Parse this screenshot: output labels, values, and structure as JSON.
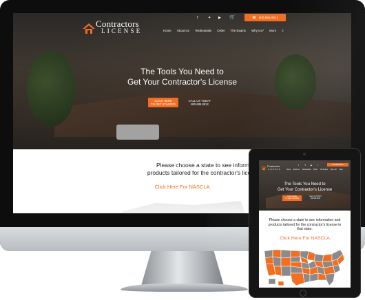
{
  "site": {
    "logo_line1": "Contractors",
    "logo_line2": "LICENSE",
    "phone": "800.685.0812",
    "nav": [
      "Home",
      "About Us",
      "Testimonials",
      "Order",
      "The Exams",
      "Why Us?",
      "More"
    ],
    "hero_title_line1": "The Tools You Need to",
    "hero_title_line2": "Get Your Contractor's License",
    "cta_primary_line1": "CLICK HERE",
    "cta_primary_line2": "TO GET STARTED",
    "cta_secondary_line1": "CALL US TODAY",
    "cta_secondary_line2": "800.685.0812",
    "content_line1": "Please choose a state to see information and",
    "content_line2": "products tailored for the contractor's license in that s",
    "content_link": "Click Here For NASCLA"
  },
  "tablet": {
    "content_line1": "Please choose a state to see information and",
    "content_line2": "products tailored for the contractor's license in",
    "content_line3": "that state.",
    "content_link": "Click Here For NASCLA"
  },
  "icons": [
    "facebook-icon",
    "twitter-icon",
    "youtube-icon",
    "cart-icon",
    "phone-icon",
    "search-icon"
  ],
  "colors": {
    "accent": "#f26f21",
    "hero_dark": "#3a3836",
    "map_orange": "#f26f21",
    "map_gray": "#8a8a8a"
  }
}
